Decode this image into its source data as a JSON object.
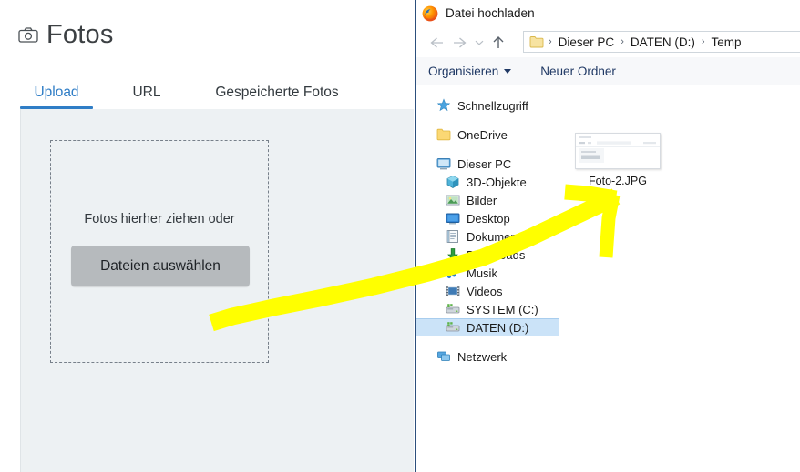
{
  "webpage": {
    "header": {
      "icon": "camera-icon",
      "title": "Fotos"
    },
    "tabs": [
      {
        "label": "Upload",
        "active": true
      },
      {
        "label": "URL",
        "active": false
      },
      {
        "label": "Gespeicherte Fotos",
        "active": false
      }
    ],
    "dropzone": {
      "hint": "Fotos hierher ziehen oder",
      "button_label": "Dateien auswählen"
    }
  },
  "dialog": {
    "title": "Datei hochladen",
    "app_icon": "firefox-icon",
    "nav": {
      "back": "arrow-left-icon",
      "forward": "arrow-right-icon",
      "recent": "chevron-down-icon",
      "up": "arrow-up-icon"
    },
    "breadcrumb": {
      "folder_icon": "folder-icon",
      "crumbs": [
        "Dieser PC",
        "DATEN (D:)",
        "Temp"
      ],
      "separator": "›"
    },
    "toolbar": {
      "organize_label": "Organisieren",
      "new_folder_label": "Neuer Ordner"
    },
    "nav_pane": {
      "items": [
        {
          "label": "Schnellzugriff",
          "icon": "star-icon",
          "level": 0,
          "selected": false,
          "gap_after": true
        },
        {
          "label": "OneDrive",
          "icon": "onedrive-folder-icon",
          "level": 0,
          "selected": false,
          "gap_after": true
        },
        {
          "label": "Dieser PC",
          "icon": "monitor-icon",
          "level": 0,
          "selected": false,
          "gap_after": false
        },
        {
          "label": "3D-Objekte",
          "icon": "cube-icon",
          "level": 1,
          "selected": false,
          "gap_after": false
        },
        {
          "label": "Bilder",
          "icon": "pictures-icon",
          "level": 1,
          "selected": false,
          "gap_after": false
        },
        {
          "label": "Desktop",
          "icon": "desktop-icon",
          "level": 1,
          "selected": false,
          "gap_after": false
        },
        {
          "label": "Dokumente",
          "icon": "documents-icon",
          "level": 1,
          "selected": false,
          "gap_after": false
        },
        {
          "label": "Downloads",
          "icon": "download-arrow-icon",
          "level": 1,
          "selected": false,
          "gap_after": false
        },
        {
          "label": "Musik",
          "icon": "music-note-icon",
          "level": 1,
          "selected": false,
          "gap_after": false
        },
        {
          "label": "Videos",
          "icon": "film-icon",
          "level": 1,
          "selected": false,
          "gap_after": false
        },
        {
          "label": "SYSTEM (C:)",
          "icon": "hard-drive-icon",
          "level": 1,
          "selected": false,
          "gap_after": false
        },
        {
          "label": "DATEN (D:)",
          "icon": "hard-drive-icon",
          "level": 1,
          "selected": true,
          "gap_after": true
        },
        {
          "label": "Netzwerk",
          "icon": "network-icon",
          "level": 0,
          "selected": false,
          "gap_after": false
        }
      ]
    },
    "file_pane": {
      "files": [
        {
          "name": "Foto-2.JPG",
          "icon": "image-thumbnail"
        }
      ]
    }
  },
  "annotation": {
    "type": "highlighter-arrow",
    "color": "#ffff00",
    "description": "arrow pointing from dropzone to file Foto-2.JPG"
  },
  "colors": {
    "accent": "#2f7dc6",
    "panel_bg": "#edf1f3",
    "button_bg": "#b6babd",
    "selection": "#cbe3f8",
    "highlighter": "#ffff00",
    "dialog_border": "#2c4f7c"
  }
}
